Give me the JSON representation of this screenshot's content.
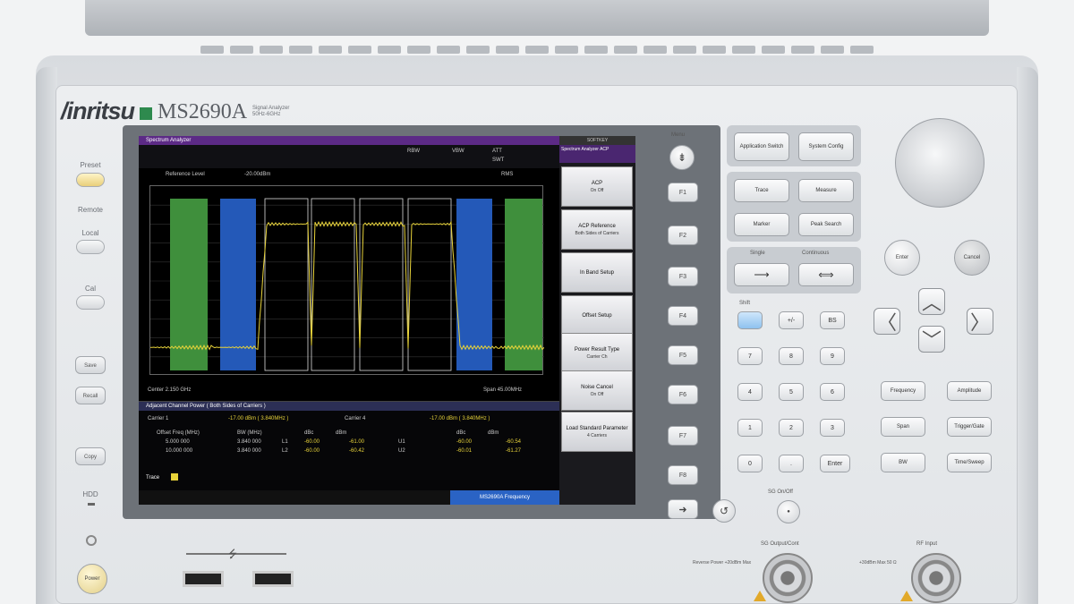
{
  "brand": {
    "name": "/inritsu",
    "model": "MS2690A",
    "model_sub": "Signal Analyzer 50Hz-6GHz"
  },
  "left_panel": {
    "preset": "Preset",
    "remote": "Remote",
    "local": "Local",
    "cal": "Cal",
    "save": "Save",
    "recall": "Recall",
    "copy": "Copy",
    "hdd": "HDD",
    "power": "Power"
  },
  "screen": {
    "title": "Spectrum Analyzer",
    "status": {
      "rbw": "RBW",
      "vbw": "VBW",
      "att": "ATT",
      "swt": "SWT"
    },
    "reference_level_label": "Reference Level",
    "reference_level_value": "-20.00dBm",
    "detector": "RMS",
    "center": "Center 2.150 GHz",
    "span": "Span 45.00MHz",
    "table_title": "Adjacent Channel Power ( Both Sides of Carriers )",
    "carrier1_label": "Carrier 1",
    "carrier1_value": "-17.00  dBm ( 3.840MHz )",
    "carrier4_label": "Carrier 4",
    "carrier4_value": "-17.00  dBm ( 3.840MHz )",
    "col_offset": "Offset Freq (MHz)",
    "col_bw": "BW (MHz)",
    "col_dbc": "dBc",
    "col_dbm": "dBm",
    "row1": {
      "offset": "5.000 000",
      "bw": "3.840 000",
      "ch": "L1",
      "dbc": "-60.00",
      "dbm": "-61.00",
      "ch2": "U1",
      "dbc2": "-60.00",
      "dbm2": "-60.54"
    },
    "row2": {
      "offset": "10.000 000",
      "bw": "3.840 000",
      "ch": "L2",
      "dbc": "-60.00",
      "dbm": "-60.42",
      "ch2": "U2",
      "dbc2": "-60.01",
      "dbm2": "-61.27"
    },
    "trace_label": "Trace",
    "bottom_status": "MS2690A Frequency"
  },
  "softkeys": {
    "header": "SOFTKEY",
    "title": "Spectrum Analyzer ACP",
    "items": [
      {
        "label": "ACP",
        "sub": "On    Off"
      },
      {
        "label": "ACP Reference",
        "sub": "Both Sides of Carriers"
      },
      {
        "label": "In Band Setup",
        "sub": ""
      },
      {
        "label": "Offset Setup",
        "sub": ""
      },
      {
        "label": "Power Result Type",
        "sub": "Carrier    Ch"
      },
      {
        "label": "Noise Cancel",
        "sub": "On    Off"
      },
      {
        "label": "Load Standard Parameter",
        "sub": "4 Carriers"
      }
    ]
  },
  "fkeys": {
    "menu": "Menu",
    "f1": "F1",
    "f2": "F2",
    "f3": "F3",
    "f4": "F4",
    "f5": "F5",
    "f6": "F6",
    "f7": "F7",
    "f8": "F8"
  },
  "right_panel": {
    "application_switch": "Application Switch",
    "system_config": "System Config",
    "trace": "Trace",
    "measure": "Measure",
    "marker": "Marker",
    "peak_search": "Peak Search",
    "single": "Single",
    "continuous": "Continuous",
    "shift": "Shift",
    "enter_round": "Enter",
    "cancel": "Cancel",
    "bs": "BS",
    "plus_minus": "+/-",
    "keys": [
      "7",
      "8",
      "9",
      "4",
      "5",
      "6",
      "1",
      "2",
      "3",
      "0",
      "."
    ],
    "enter_key": "Enter",
    "frequency": "Frequency",
    "amplitude": "Amplitude",
    "span": "Span",
    "trigger_gate": "Trigger/Gate",
    "bw": "BW",
    "time_sweep": "Time/Sweep",
    "sg_onoff": "SG On/Off",
    "sg_output": "SG Output/Cont",
    "rf_input": "RF Input",
    "sg_note": "Reverse Power +20dBm Max",
    "rf_note": "+30dBm Max 50 Ω"
  },
  "chart_data": {
    "type": "line",
    "title": "",
    "xlabel": "",
    "ylabel": "",
    "series": [
      {
        "values": [
          -95,
          -95,
          -95,
          -30,
          -30,
          -95,
          -30,
          -30,
          -95,
          -30,
          -30,
          -95,
          -30,
          -30,
          -95,
          -95,
          -95
        ]
      }
    ]
  }
}
